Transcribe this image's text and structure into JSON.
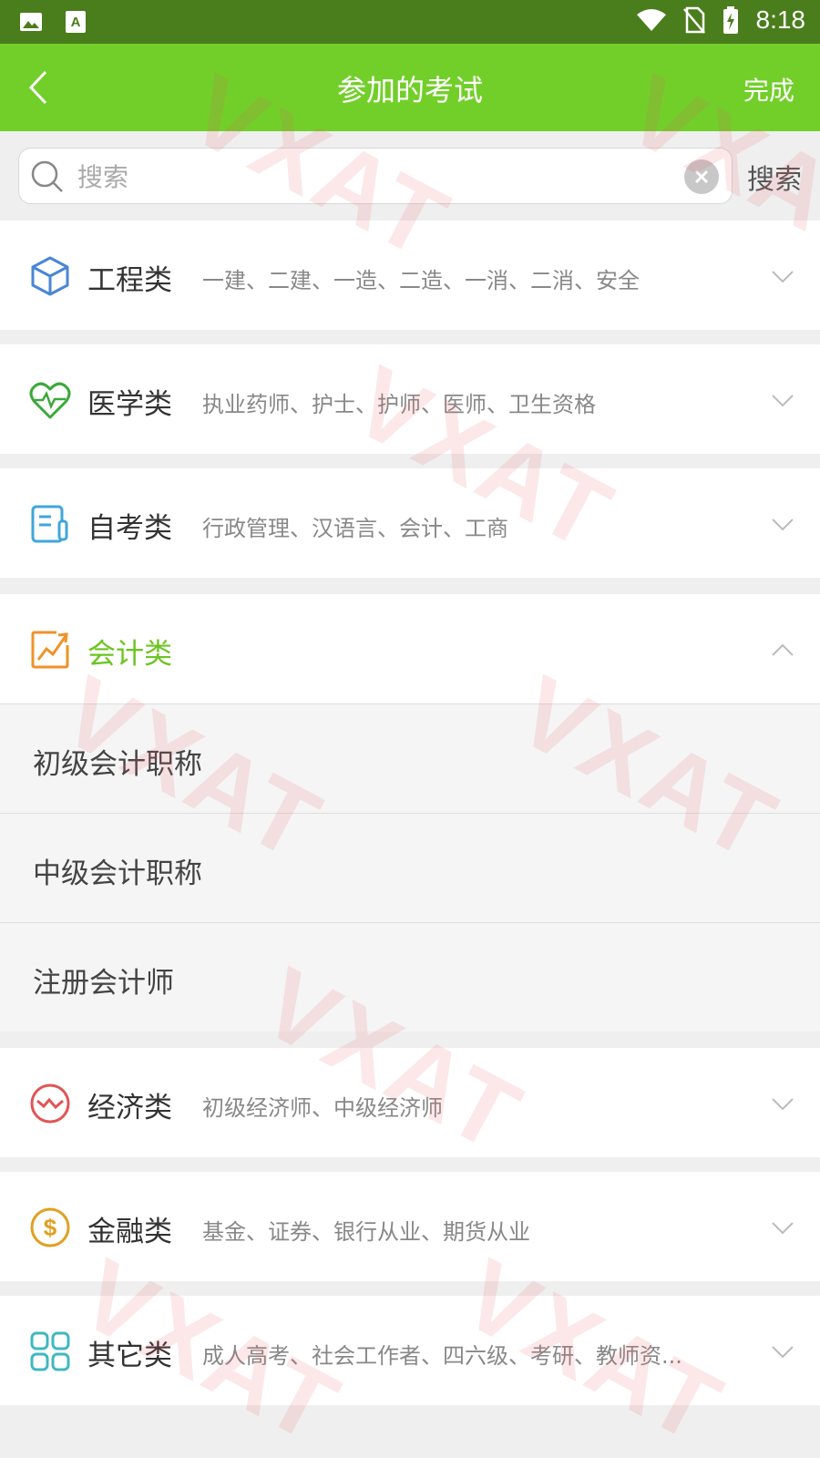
{
  "status_bar": {
    "time": "8:18"
  },
  "app_bar": {
    "title": "参加的考试",
    "done_label": "完成"
  },
  "search": {
    "placeholder": "搜索",
    "button_label": "搜索"
  },
  "categories": [
    {
      "name": "工程类",
      "desc": "一建、二建、一造、二造、一消、二消、安全",
      "icon": "cube-icon",
      "color": "#4a86d8"
    },
    {
      "name": "医学类",
      "desc": "执业药师、护士、护师、医师、卫生资格",
      "icon": "heartbeat-icon",
      "color": "#3aa83a"
    },
    {
      "name": "自考类",
      "desc": "行政管理、汉语言、会计、工商",
      "icon": "notebook-icon",
      "color": "#3fa6dc"
    },
    {
      "name": "会计类",
      "desc": "",
      "icon": "trend-chart-icon",
      "color": "#f0922a",
      "expanded": true,
      "items": [
        "初级会计职称",
        "中级会计职称",
        "注册会计师"
      ]
    },
    {
      "name": "经济类",
      "desc": "初级经济师、中级经济师",
      "icon": "wave-circle-icon",
      "color": "#e05555"
    },
    {
      "name": "金融类",
      "desc": "基金、证券、银行从业、期货从业",
      "icon": "dollar-icon",
      "color": "#e0a020"
    },
    {
      "name": "其它类",
      "desc": "成人高考、社会工作者、四六级、考研、教师资...",
      "icon": "grid-icon",
      "color": "#3fb8c0"
    }
  ],
  "colors": {
    "status_bar": "#4a7d1c",
    "app_bar": "#72cf2a",
    "active_text": "#6cc421"
  }
}
